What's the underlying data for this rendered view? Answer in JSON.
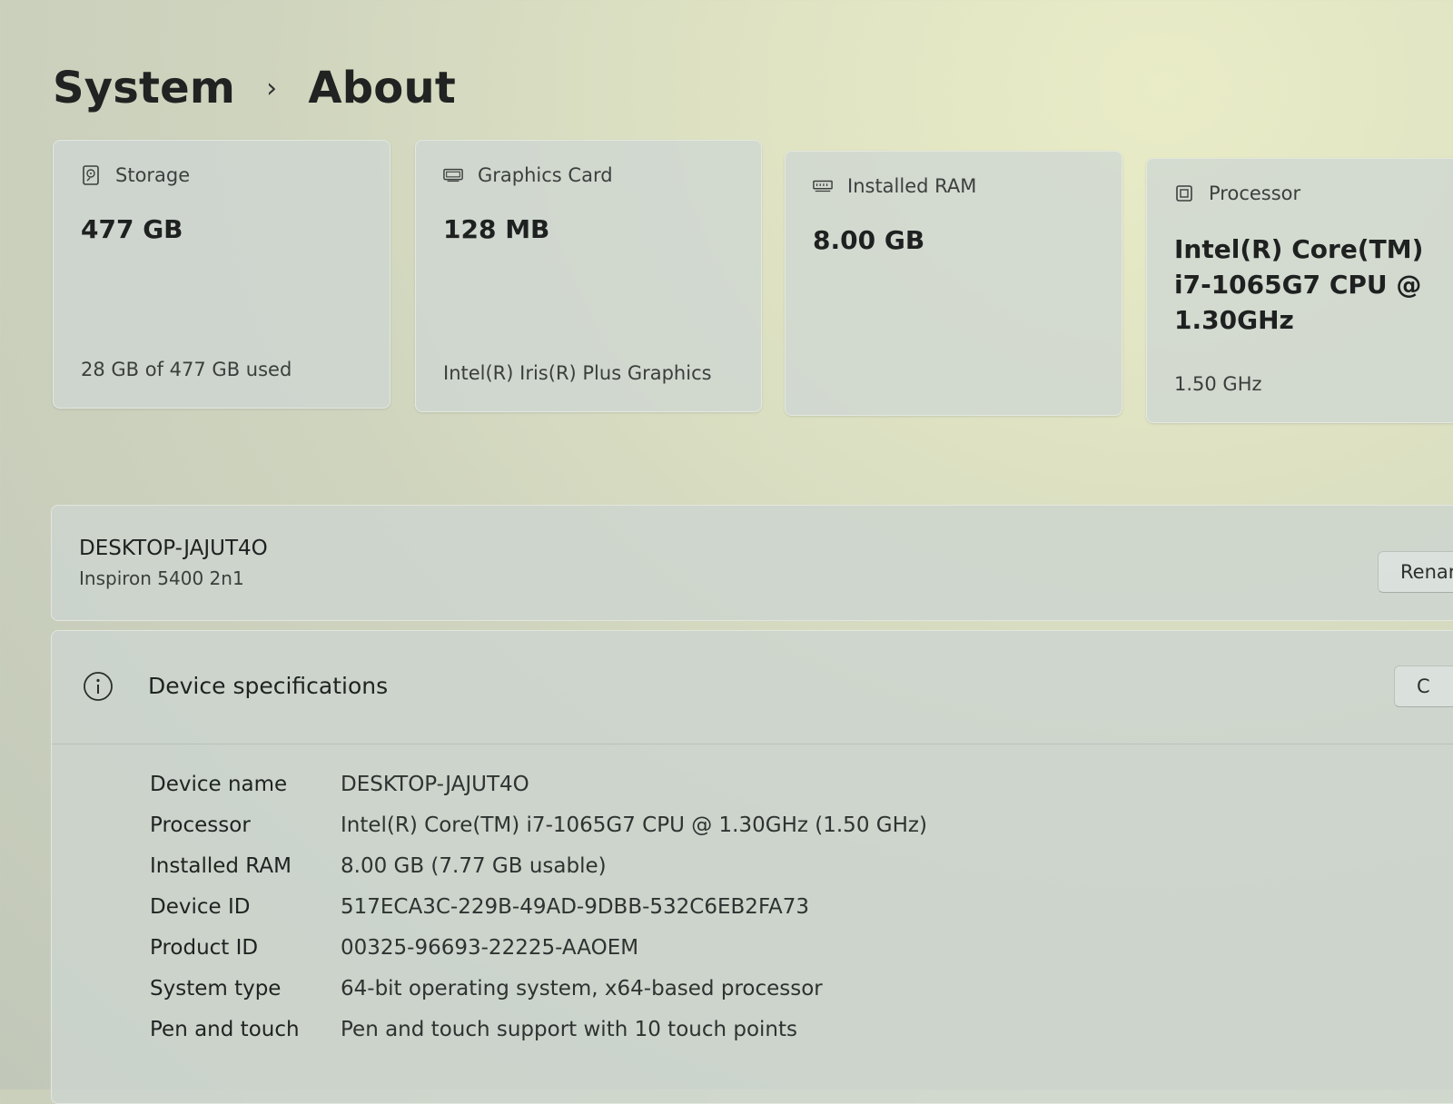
{
  "breadcrumb": {
    "parent": "System",
    "separator": "›",
    "current": "About"
  },
  "cards": {
    "storage": {
      "label": "Storage",
      "value": "477 GB",
      "detail": "28 GB of 477 GB used",
      "icon": "hard-drive-icon"
    },
    "graphics": {
      "label": "Graphics Card",
      "value": "128 MB",
      "detail": "Intel(R) Iris(R) Plus Graphics",
      "icon": "display-adapter-icon"
    },
    "ram": {
      "label": "Installed RAM",
      "value": "8.00 GB",
      "icon": "memory-icon"
    },
    "processor": {
      "label": "Processor",
      "value_lines": [
        "Intel(R) Core(TM)",
        "i7-1065G7 CPU @",
        "1.30GHz"
      ],
      "detail": "1.50 GHz",
      "icon": "processor-icon"
    }
  },
  "device": {
    "name": "DESKTOP-JAJUT4O",
    "model": "Inspiron 5400 2n1",
    "rename_label": "Renar"
  },
  "specs": {
    "title": "Device specifications",
    "copy_label": "C",
    "rows": [
      {
        "key": "Device name",
        "value": "DESKTOP-JAJUT4O"
      },
      {
        "key": "Processor",
        "value": "Intel(R) Core(TM) i7-1065G7 CPU @ 1.30GHz (1.50 GHz)"
      },
      {
        "key": "Installed RAM",
        "value": "8.00 GB (7.77 GB usable)"
      },
      {
        "key": "Device ID",
        "value": "517ECA3C-229B-49AD-9DBB-532C6EB2FA73"
      },
      {
        "key": "Product ID",
        "value": "00325-96693-22225-AAOEM"
      },
      {
        "key": "System type",
        "value": "64-bit operating system, x64-based processor"
      },
      {
        "key": "Pen and touch",
        "value": "Pen and touch support with 10 touch points"
      }
    ]
  }
}
